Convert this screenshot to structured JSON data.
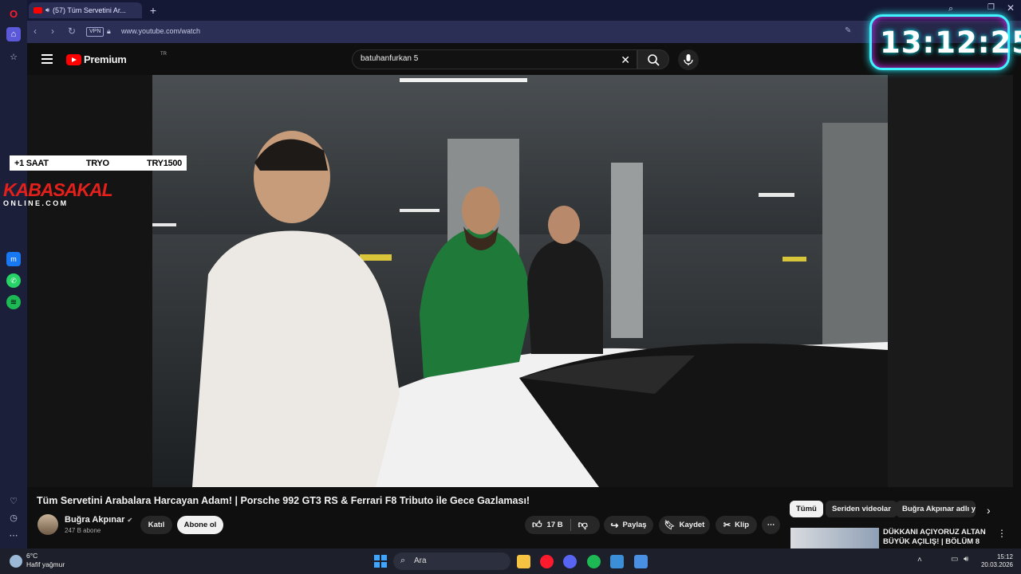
{
  "browser": {
    "tab_title": "(57) Tüm Servetini Ar...",
    "address": "www.youtube.com/watch",
    "vpn_label": "VPN"
  },
  "youtube": {
    "logo_text": "Premium",
    "logo_region": "TR",
    "search_value": "batuhanfurkan 5",
    "video": {
      "title": "Tüm Servetini Arabalara Harcayan Adam! | Porsche 992 GT3 RS & Ferrari F8 Tributo ile Gece Gazlaması!",
      "channel": "Buğra Akpınar",
      "subscribers": "247 B abone",
      "join_label": "Katıl",
      "subscribe_label": "Abone ol",
      "likes": "17 B",
      "share_label": "Paylaş",
      "save_label": "Kaydet",
      "clip_label": "Klip"
    },
    "chips": [
      "Tümü",
      "Seriden videolar",
      "Buğra Akpınar adlı yü"
    ],
    "recommendation": {
      "title_line1": "DÜKKANI AÇIYORUZ ALTAN",
      "title_line2": "BÜYÜK AÇILIŞ! | BÖLÜM 8"
    }
  },
  "overlay": {
    "ticker": [
      "+1 SAAT",
      "TRYO",
      "TRY1500"
    ],
    "brand_main": "KABASAKAL",
    "brand_sub": "ONLINE.COM",
    "clock": "13:12:25"
  },
  "taskbar": {
    "weather_temp": "6°C",
    "weather_desc": "Hafif yağmur",
    "search_label": "Ara",
    "time": "15:12",
    "date": "20.03.2026"
  }
}
